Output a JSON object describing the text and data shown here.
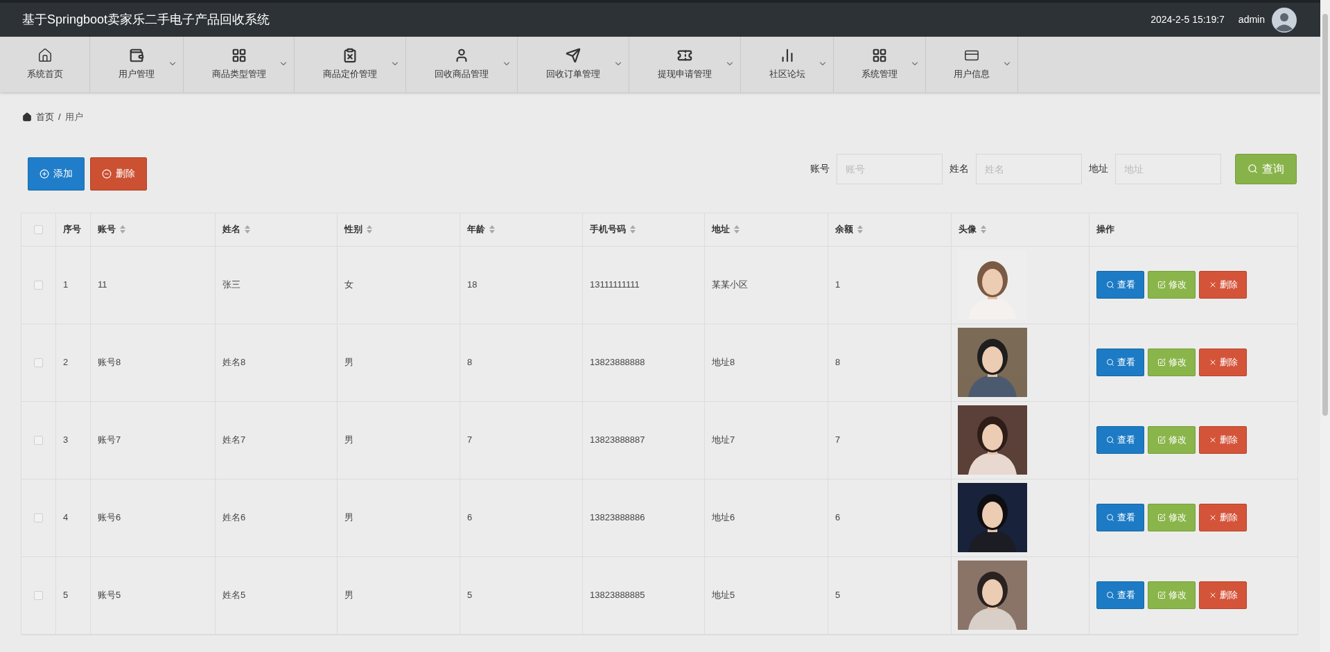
{
  "header": {
    "title": "基于Springboot卖家乐二手电子产品回收系统",
    "datetime": "2024-2-5 15:19:7",
    "username": "admin"
  },
  "nav": [
    {
      "label": "系统首页",
      "dropdown": false
    },
    {
      "label": "用户管理",
      "dropdown": true
    },
    {
      "label": "商品类型管理",
      "dropdown": true
    },
    {
      "label": "商品定价管理",
      "dropdown": true
    },
    {
      "label": "回收商品管理",
      "dropdown": true
    },
    {
      "label": "回收订单管理",
      "dropdown": true
    },
    {
      "label": "提现申请管理",
      "dropdown": true
    },
    {
      "label": "社区论坛",
      "dropdown": true
    },
    {
      "label": "系统管理",
      "dropdown": true
    },
    {
      "label": "用户信息",
      "dropdown": true
    }
  ],
  "breadcrumb": {
    "items": [
      "首页",
      "用户"
    ],
    "separator": "/"
  },
  "actions": [
    {
      "label": "添加",
      "kind": "add"
    },
    {
      "label": "删除",
      "kind": "delete"
    }
  ],
  "search": {
    "fields": [
      {
        "label": "账号",
        "placeholder": "账号"
      },
      {
        "label": "姓名",
        "placeholder": "姓名"
      },
      {
        "label": "地址",
        "placeholder": "地址"
      }
    ],
    "button": "查询"
  },
  "table": {
    "all_checked": false,
    "columns": [
      {
        "label": "序号",
        "sortable": false
      },
      {
        "label": "账号",
        "sortable": true
      },
      {
        "label": "姓名",
        "sortable": true
      },
      {
        "label": "性别",
        "sortable": true
      },
      {
        "label": "年龄",
        "sortable": true
      },
      {
        "label": "手机号码",
        "sortable": true
      },
      {
        "label": "地址",
        "sortable": true
      },
      {
        "label": "余额",
        "sortable": true
      },
      {
        "label": "头像",
        "sortable": true
      },
      {
        "label": "操作",
        "sortable": false
      }
    ],
    "rows": [
      {
        "checked": false,
        "cells": [
          "1",
          "11",
          "张三",
          "女",
          "18",
          "13111111111",
          "某某小区",
          "1"
        ],
        "buttons": [
          {
            "label": "查看",
            "kind": "view"
          },
          {
            "label": "修改",
            "kind": "edit"
          },
          {
            "label": "删除",
            "kind": "delete"
          }
        ]
      },
      {
        "checked": false,
        "cells": [
          "2",
          "账号8",
          "姓名8",
          "男",
          "8",
          "13823888888",
          "地址8",
          "8"
        ],
        "buttons": [
          {
            "label": "查看",
            "kind": "view"
          },
          {
            "label": "修改",
            "kind": "edit"
          },
          {
            "label": "删除",
            "kind": "delete"
          }
        ]
      },
      {
        "checked": false,
        "cells": [
          "3",
          "账号7",
          "姓名7",
          "男",
          "7",
          "13823888887",
          "地址7",
          "7"
        ],
        "buttons": [
          {
            "label": "查看",
            "kind": "view"
          },
          {
            "label": "修改",
            "kind": "edit"
          },
          {
            "label": "删除",
            "kind": "delete"
          }
        ]
      },
      {
        "checked": false,
        "cells": [
          "4",
          "账号6",
          "姓名6",
          "男",
          "6",
          "13823888886",
          "地址6",
          "6"
        ],
        "buttons": [
          {
            "label": "查看",
            "kind": "view"
          },
          {
            "label": "修改",
            "kind": "edit"
          },
          {
            "label": "删除",
            "kind": "delete"
          }
        ]
      },
      {
        "checked": false,
        "cells": [
          "5",
          "账号5",
          "姓名5",
          "男",
          "5",
          "13823888885",
          "地址5",
          "5"
        ],
        "buttons": [
          {
            "label": "查看",
            "kind": "view"
          },
          {
            "label": "修改",
            "kind": "edit"
          },
          {
            "label": "删除",
            "kind": "delete"
          }
        ]
      }
    ]
  }
}
